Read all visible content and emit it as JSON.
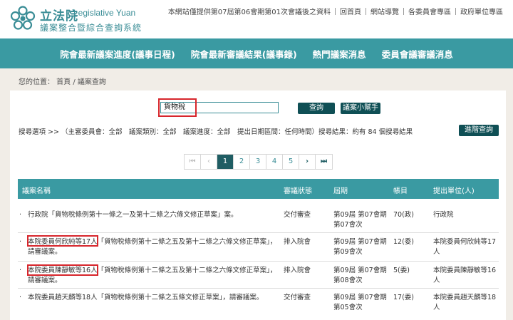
{
  "header": {
    "logo_cn": "立法院",
    "logo_en": "Legislative Yuan",
    "logo_sub": "議案整合暨綜合查詢系統",
    "top_links": [
      "本網站僅提供第07屆第06會期第01次會議後之資料",
      "回首頁",
      "網站導覽",
      "各委員會專區",
      "政府單位專區"
    ]
  },
  "nav": {
    "items": [
      "院會最新議案進度(議事日程)",
      "院會最新審議結果(議事錄)",
      "熱門議案消息",
      "委員會議審議消息"
    ]
  },
  "breadcrumb": "您的位置： 首頁 / 議案查詢",
  "search": {
    "value": "貨物稅",
    "query_label": "查詢",
    "helper_label": "議案小幫手",
    "filters": "搜尋選項 >>  （主審委員會：全部　議案類別：全部　議案進度：全部　提出日期區間：任何時間）搜尋結果：約有 84 個搜尋結果",
    "advanced_label": "進階查詢"
  },
  "pagination": {
    "first": "⏮",
    "prev": "‹",
    "pages": [
      "1",
      "2",
      "3",
      "4",
      "5"
    ],
    "active": "1",
    "next": "›",
    "last": "⏭"
  },
  "table": {
    "headers": [
      "議案名稱",
      "審議狀態",
      "屆期",
      "帳目",
      "提出單位(人)"
    ],
    "rows": [
      {
        "name_prefix": "",
        "name": "行政院「貨物稅條例第十一條之一及第十二條之六條文修正草案」案。",
        "status": "交付審查",
        "term": "第09屆 第07會期 第07會次",
        "code": "70(政)",
        "unit": "行政院"
      },
      {
        "name_prefix": "本院委員何欣純等17人",
        "name": "「貨物稅條例第十二條之五及第十二條之六條文修正草案」，請審議案。",
        "status": "排入院會",
        "term": "第09屆 第07會期 第09會次",
        "code": "12(委)",
        "unit": "本院委員何欣純等17人"
      },
      {
        "name_prefix": "本院委員陳靜敏等16人",
        "name": "「貨物稅條例第十二條之五及第十二條之六條文修正草案」，請審議案。",
        "status": "排入院會",
        "term": "第09屆 第07會期 第08會次",
        "code": "5(委)",
        "unit": "本院委員陳靜敏等16人"
      },
      {
        "name_prefix": "",
        "name": "本院委員趙天麟等18人「貨物稅條例第十二條之五條文修正草案」，請審議案。",
        "status": "交付審查",
        "term": "第09屆 第07會期 第05會次",
        "code": "17(委)",
        "unit": "本院委員趙天麟等18人"
      }
    ]
  },
  "colors": {
    "brand": "#3a9aa2",
    "button_dark": "#0f4f55",
    "highlight": "#d7262c"
  }
}
